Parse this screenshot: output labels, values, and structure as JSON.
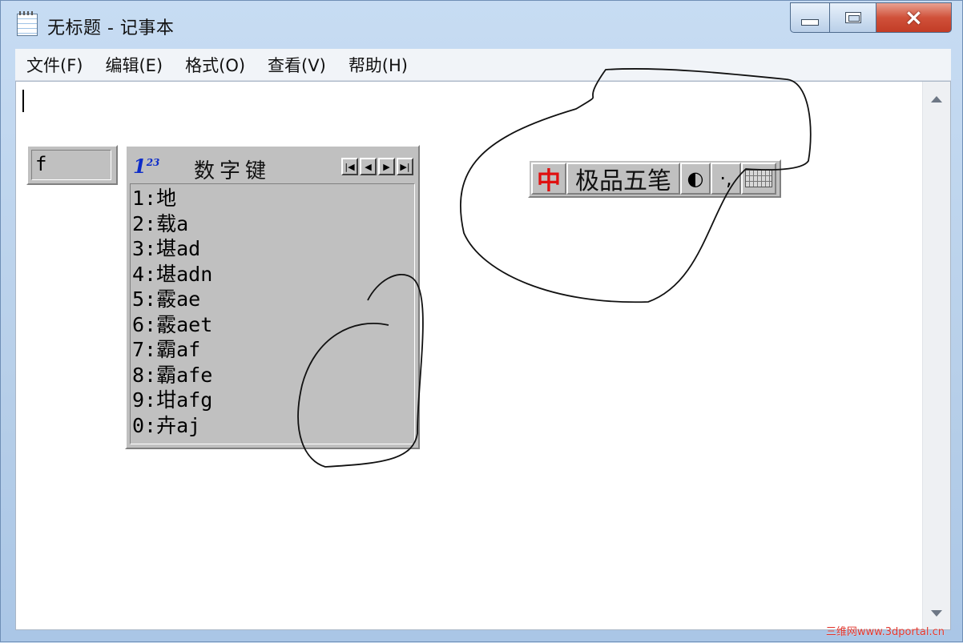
{
  "window": {
    "title": "无标题 - 记事本",
    "buttons": {
      "minimize": "minimize",
      "maximize": "maximize",
      "close": "×"
    }
  },
  "menubar": {
    "items": [
      {
        "label": "文件(F)"
      },
      {
        "label": "编辑(E)"
      },
      {
        "label": "格式(O)"
      },
      {
        "label": "查看(V)"
      },
      {
        "label": "帮助(H)"
      }
    ]
  },
  "ime": {
    "input_text": "f",
    "candidate_window": {
      "logo": "1",
      "logo_sup": "23",
      "title": "数字键",
      "pager": [
        "|◀",
        "◀",
        "▶",
        "▶|"
      ],
      "candidates": [
        "1:地",
        "2:载a",
        "3:堪ad",
        "4:堪adn",
        "5:霰ae",
        "6:霰aet",
        "7:霸af",
        "8:霸afe",
        "9:坩afg",
        "0:卉aj"
      ]
    },
    "status_bar": {
      "mode": "中",
      "name": "极品五笔",
      "shape": "◐",
      "punct": "·,",
      "keyboard_icon": "keyboard-icon"
    }
  },
  "watermark": "三维网www.3dportal.cn",
  "colors": {
    "accent_red": "#e01010",
    "logo_blue": "#0d2cc9",
    "classic_gray": "#c0c0c0"
  }
}
